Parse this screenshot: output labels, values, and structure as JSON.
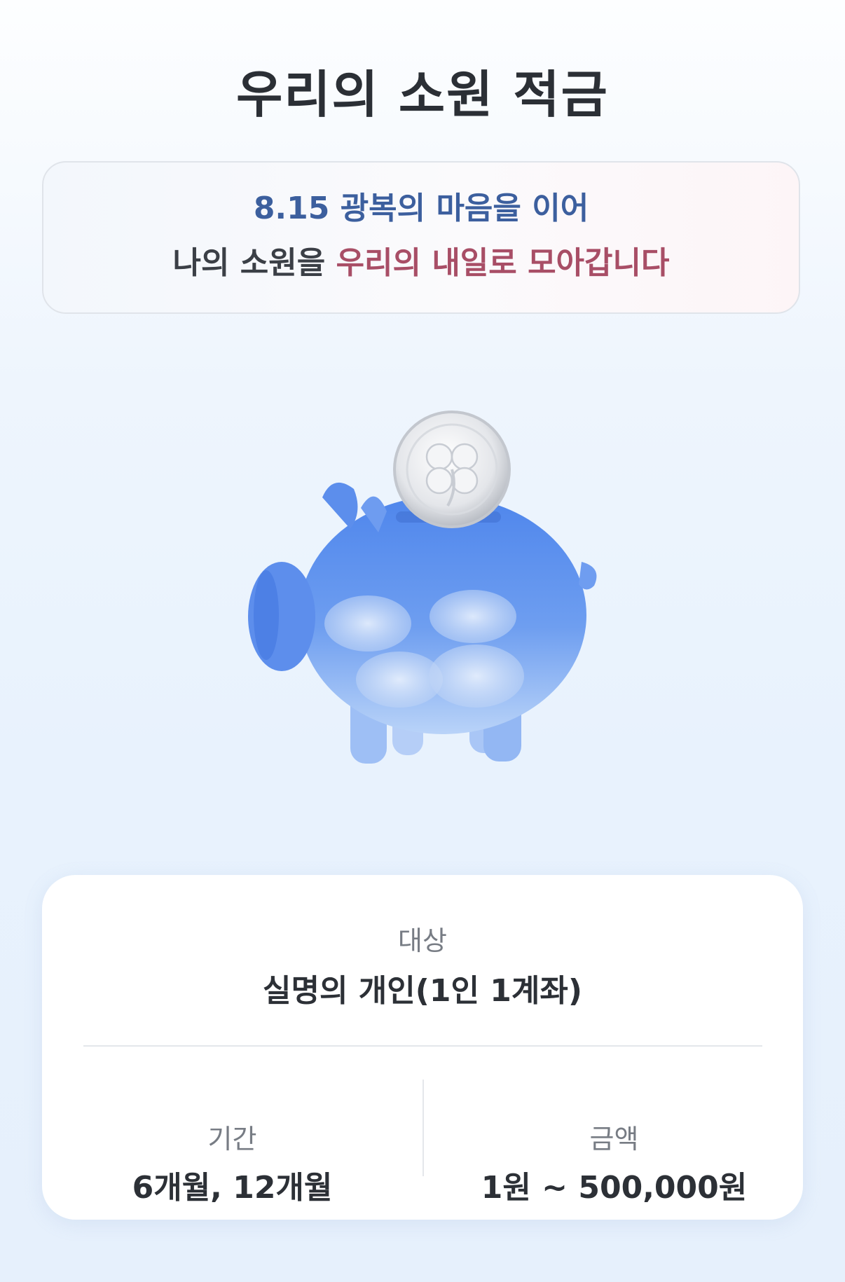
{
  "header": {
    "title": "우리의 소원 적금"
  },
  "slogan": {
    "line1": "8.15 광복의 마음을 이어",
    "line2_prefix": "나의 소원을 ",
    "line2_highlight": "우리의 내일로 모아갑니다"
  },
  "hero": {
    "icon": "piggy-bank-with-clover-coin-icon",
    "colors": {
      "pig_body": "#5d8fec",
      "coin": "#e9ebef"
    }
  },
  "info": {
    "target": {
      "label": "대상",
      "value": "실명의 개인(1인 1계좌)"
    },
    "period": {
      "label": "기간",
      "value": "6개월, 12개월"
    },
    "amount": {
      "label": "금액",
      "value": "1원 ~ 500,000원"
    }
  },
  "colors": {
    "title": "#2b2f35",
    "slogan_blue": "#3c5f9e",
    "slogan_red": "#a84e66",
    "label_gray": "#777c84"
  }
}
